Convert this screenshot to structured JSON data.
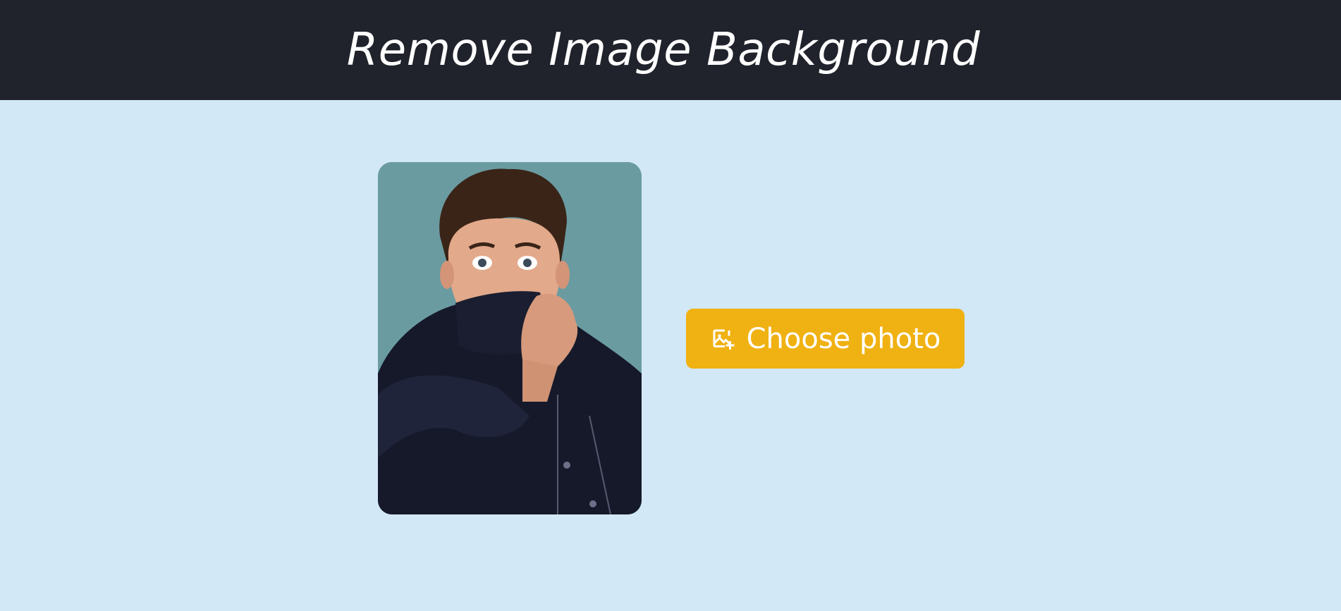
{
  "header": {
    "title": "Remove Image Background"
  },
  "preview": {
    "subject": "photo-of-person"
  },
  "upload": {
    "label": "Choose photo",
    "icon": "add-photo-icon"
  },
  "colors": {
    "header_bg": "#20232b",
    "page_bg": "#d2e8f7",
    "button_bg": "#f0b113",
    "photo_bg": "#6e9ea3"
  }
}
